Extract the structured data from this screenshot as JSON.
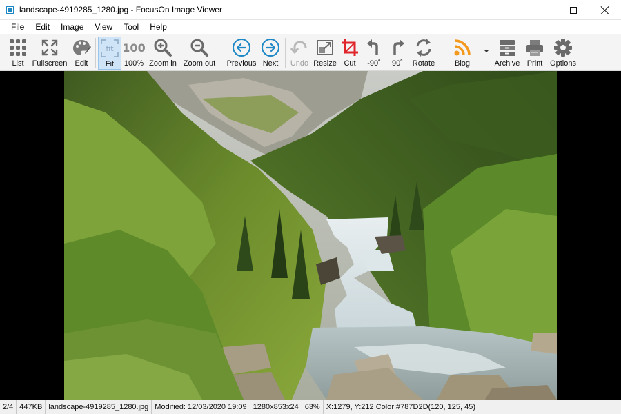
{
  "window": {
    "title": "landscape-4919285_1280.jpg - FocusOn Image Viewer"
  },
  "menu": [
    "File",
    "Edit",
    "Image",
    "View",
    "Tool",
    "Help"
  ],
  "toolbar": {
    "list": "List",
    "fullscreen": "Fullscreen",
    "edit": "Edit",
    "fit": "Fit",
    "fit_icon_text": "fit",
    "actual_size": "100%",
    "actual_size_icon_text": "100",
    "zoom_in": "Zoom in",
    "zoom_out": "Zoom out",
    "previous": "Previous",
    "next": "Next",
    "undo": "Undo",
    "resize": "Resize",
    "cut": "Cut",
    "rotate_left": "-90˚",
    "rotate_right": "90˚",
    "rotate": "Rotate",
    "blog": "Blog",
    "archive": "Archive",
    "print": "Print",
    "options": "Options"
  },
  "toolbar_state": {
    "active": "Fit",
    "disabled": [
      "Undo"
    ]
  },
  "status": {
    "position": "2/4",
    "file_size": "447KB",
    "file_name": "landscape-4919285_1280.jpg",
    "modified": "Modified: 12/03/2020 19:09",
    "dimensions": "1280x853x24",
    "zoom": "63%",
    "pixel_info": "X:1279, Y:212 Color:#787D2D(120, 125, 45)"
  },
  "colors": {
    "accent_blue": "#1e88c7",
    "cut_red": "#e0262b",
    "blog_orange": "#f39a1e",
    "active_button": "#cfe4f7"
  },
  "image": {
    "subject": "waterfall-forest-landscape",
    "pixel_color_hex": "#787D2D"
  }
}
